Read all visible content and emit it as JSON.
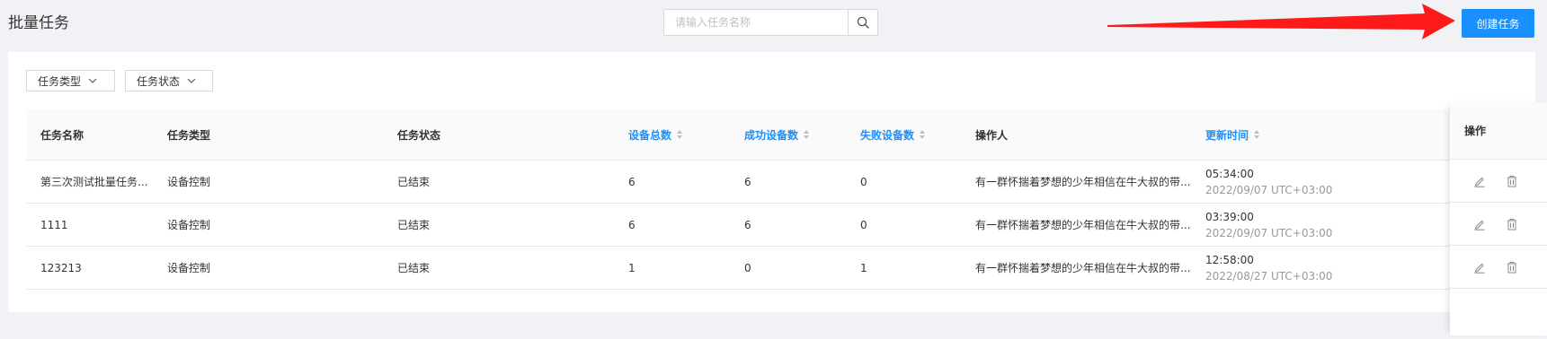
{
  "header": {
    "title": "批量任务",
    "search_placeholder": "请输入任务名称",
    "create_label": "创建任务"
  },
  "filters": [
    {
      "label": "任务类型"
    },
    {
      "label": "任务状态"
    }
  ],
  "table": {
    "columns": {
      "name": "任务名称",
      "type": "任务类型",
      "status": "任务状态",
      "total": "设备总数",
      "success": "成功设备数",
      "failed": "失败设备数",
      "operator": "操作人",
      "updated": "更新时间",
      "ops": "操作"
    },
    "rows": [
      {
        "name": "第三次测试批量任务...",
        "type": "设备控制",
        "status": "已结束",
        "total": "6",
        "success": "6",
        "failed": "0",
        "operator": "有一群怀揣着梦想的少年相信在牛大叔的带...",
        "time": "05:34:00",
        "date": "2022/09/07 UTC+03:00"
      },
      {
        "name": "1111",
        "type": "设备控制",
        "status": "已结束",
        "total": "6",
        "success": "6",
        "failed": "0",
        "operator": "有一群怀揣着梦想的少年相信在牛大叔的带...",
        "time": "03:39:00",
        "date": "2022/09/07 UTC+03:00"
      },
      {
        "name": "123213",
        "type": "设备控制",
        "status": "已结束",
        "total": "1",
        "success": "0",
        "failed": "1",
        "operator": "有一群怀揣着梦想的少年相信在牛大叔的带...",
        "time": "12:58:00",
        "date": "2022/08/27 UTC+03:00"
      }
    ]
  },
  "colors": {
    "accent": "#1890ff",
    "annotation_arrow": "#ff1a1a"
  }
}
